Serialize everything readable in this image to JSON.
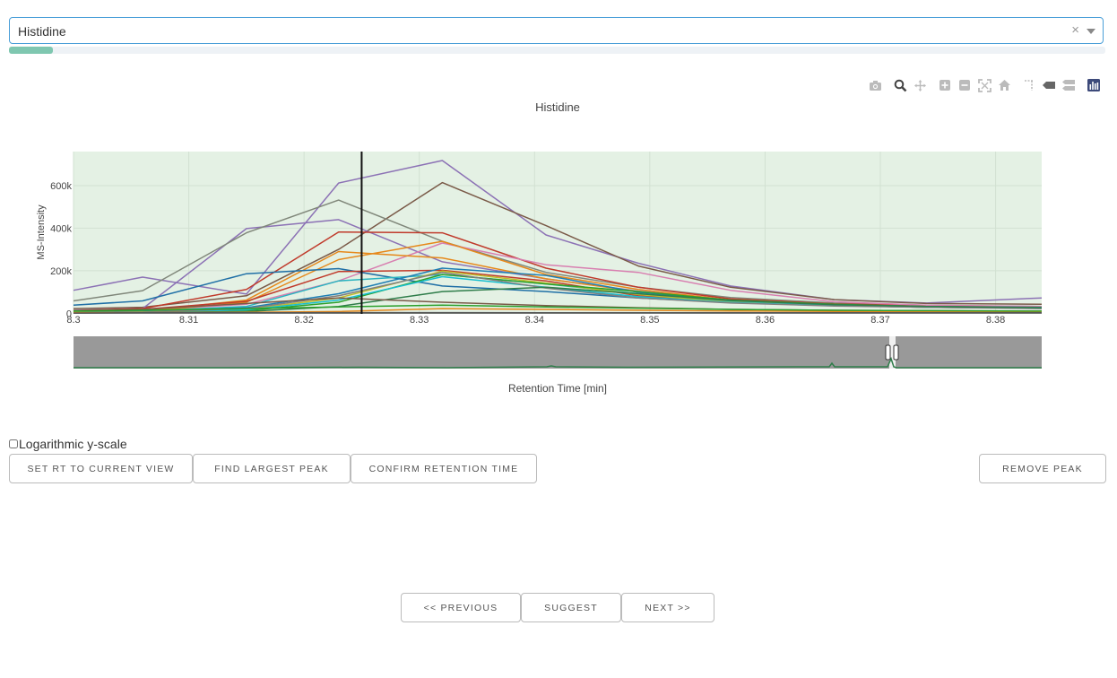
{
  "metabolite_select": {
    "value": "Histidine",
    "clear_symbol": "×"
  },
  "progress": {
    "fraction": 0.04
  },
  "modebar": [
    "camera-icon",
    "zoom-icon",
    "pan-icon",
    "zoom-in-icon",
    "zoom-out-icon",
    "autoscale-icon",
    "reset-axes-icon",
    "spike-lines-icon",
    "hover-closest-icon",
    "hover-compare-icon",
    "plotly-logo-icon"
  ],
  "chart_data": {
    "type": "line",
    "title": "Histidine",
    "xlabel": "Retention Time [min]",
    "ylabel": "MS-Intensity",
    "xlim": [
      8.3,
      8.384
    ],
    "ylim": [
      -3000,
      760000
    ],
    "x_ticks": [
      "8.3",
      "8.31",
      "8.32",
      "8.33",
      "8.34",
      "8.35",
      "8.36",
      "8.37",
      "8.38"
    ],
    "y_ticks": [
      "0",
      "200k",
      "400k",
      "600k"
    ],
    "x_tick_values": [
      8.3,
      8.31,
      8.32,
      8.33,
      8.34,
      8.35,
      8.36,
      8.37,
      8.38
    ],
    "y_tick_values": [
      0,
      200000,
      400000,
      600000
    ],
    "background": "#e4f1e4",
    "grid": true,
    "vertical_marker_x": 8.325,
    "x": [
      8.3,
      8.306,
      8.315,
      8.323,
      8.332,
      8.341,
      8.349,
      8.357,
      8.366,
      8.374,
      8.384
    ],
    "series": [
      {
        "color": "#8c72b5",
        "values": [
          108000,
          170000,
          90000,
          612000,
          718000,
          368000,
          235000,
          128000,
          64000,
          48000,
          72000
        ]
      },
      {
        "color": "#7a5a48",
        "values": [
          22000,
          28000,
          82000,
          300000,
          614000,
          412000,
          222000,
          122000,
          64000,
          46000,
          42000
        ]
      },
      {
        "color": "#8c72b5",
        "values": [
          14000,
          22000,
          398000,
          440000,
          242000,
          162000,
          104000,
          62000,
          44000,
          36000,
          30000
        ]
      },
      {
        "color": "#80877a",
        "values": [
          58000,
          106000,
          378000,
          532000,
          338000,
          192000,
          122000,
          74000,
          48000,
          36000,
          32000
        ]
      },
      {
        "color": "#c03a2b",
        "values": [
          12000,
          22000,
          112000,
          382000,
          378000,
          212000,
          122000,
          68000,
          44000,
          36000,
          30000
        ]
      },
      {
        "color": "#d87fb0",
        "values": [
          8000,
          14000,
          42000,
          152000,
          330000,
          228000,
          192000,
          108000,
          54000,
          38000,
          32000
        ]
      },
      {
        "color": "#e6881a",
        "values": [
          6000,
          10000,
          62000,
          290000,
          260000,
          162000,
          102000,
          58000,
          40000,
          32000,
          28000
        ]
      },
      {
        "color": "#e6881a",
        "values": [
          4000,
          8000,
          52000,
          252000,
          338000,
          182000,
          112000,
          62000,
          40000,
          32000,
          26000
        ]
      },
      {
        "color": "#1f6fa6",
        "values": [
          38000,
          58000,
          186000,
          210000,
          128000,
          102000,
          72000,
          50000,
          38000,
          30000,
          26000
        ]
      },
      {
        "color": "#c03a2b",
        "values": [
          12000,
          18000,
          56000,
          196000,
          202000,
          152000,
          82000,
          52000,
          36000,
          28000,
          24000
        ]
      },
      {
        "color": "#2ab3c0",
        "values": [
          6000,
          10000,
          32000,
          152000,
          182000,
          138000,
          92000,
          56000,
          38000,
          30000,
          26000
        ]
      },
      {
        "color": "#1f7fb4",
        "values": [
          4000,
          8000,
          26000,
          92000,
          212000,
          178000,
          98000,
          62000,
          40000,
          32000,
          28000
        ]
      },
      {
        "color": "#bfbc2a",
        "values": [
          4000,
          6000,
          18000,
          72000,
          198000,
          142000,
          88000,
          52000,
          36000,
          28000,
          24000
        ]
      },
      {
        "color": "#2ca02c",
        "values": [
          2000,
          4000,
          12000,
          52000,
          182000,
          138000,
          102000,
          62000,
          42000,
          32000,
          26000
        ]
      },
      {
        "color": "#17becf",
        "values": [
          2000,
          4000,
          16000,
          62000,
          172000,
          122000,
          78000,
          50000,
          36000,
          28000,
          24000
        ]
      },
      {
        "color": "#7f7f7f",
        "values": [
          3000,
          5000,
          22000,
          82000,
          192000,
          118000,
          72000,
          48000,
          34000,
          28000,
          22000
        ]
      },
      {
        "color": "#2f7d4a",
        "values": [
          2000,
          3000,
          8000,
          32000,
          102000,
          122000,
          92000,
          60000,
          40000,
          32000,
          26000
        ]
      },
      {
        "color": "#7a5a48",
        "values": [
          12000,
          18000,
          46000,
          72000,
          52000,
          36000,
          26000,
          18000,
          14000,
          12000,
          10000
        ]
      },
      {
        "color": "#e6881a",
        "values": [
          2000,
          3000,
          4000,
          8000,
          22000,
          18000,
          14000,
          11000,
          9000,
          8000,
          8000
        ]
      },
      {
        "color": "#2ca02c",
        "values": [
          10000,
          14000,
          22000,
          30000,
          38000,
          30000,
          24000,
          18000,
          14000,
          12000,
          10000
        ]
      },
      {
        "color": "#555555",
        "values": [
          1000,
          2000,
          2000,
          3000,
          3000,
          2000,
          2000,
          2000,
          2000,
          2000,
          2000
        ]
      }
    ]
  },
  "logscale": {
    "label": "Logarithmic y-scale",
    "checked": false
  },
  "buttons": {
    "set_rt": "SET RT TO CURRENT VIEW",
    "find_peak": "FIND LARGEST PEAK",
    "confirm_rt": "CONFIRM RETENTION TIME",
    "remove_peak": "REMOVE PEAK",
    "previous": "<< PREVIOUS",
    "suggest": "SUGGEST",
    "next": "NEXT >>"
  }
}
